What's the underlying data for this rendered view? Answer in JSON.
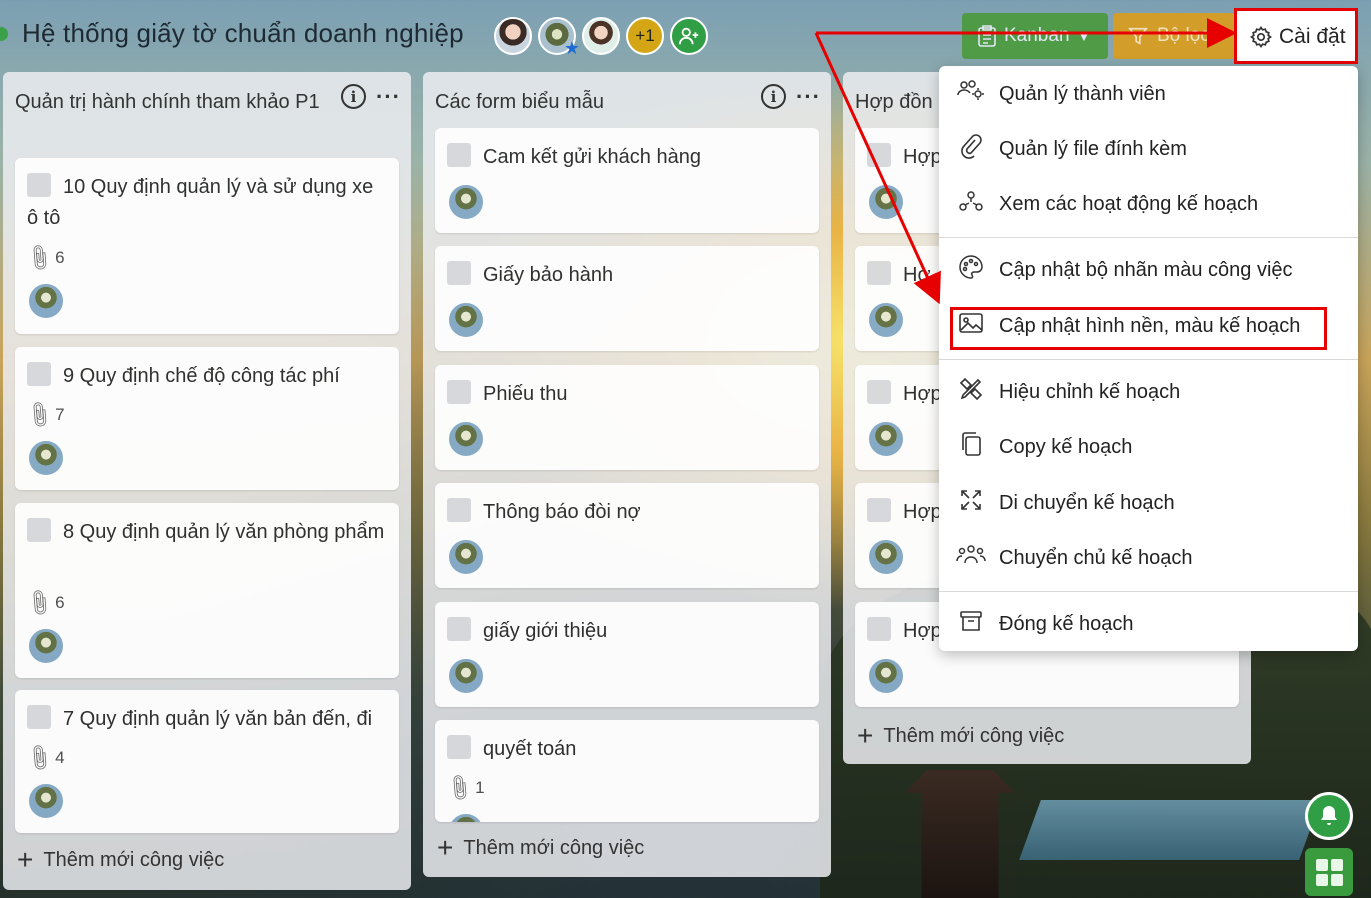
{
  "header": {
    "board_title": "Hệ thống giấy tờ chuẩn doanh nghiệp",
    "more_members": "+1",
    "view_label": "Kanban",
    "filter_label": "Bộ lọc",
    "settings_label": "Cài đặt"
  },
  "columns": [
    {
      "title": "Quản trị hành chính tham khảo P1",
      "cards": [
        {
          "title": "10 Quy định quản lý và sử dụng xe ô tô",
          "attachments": "6"
        },
        {
          "title": "9 Quy định chế độ công tác phí",
          "attachments": "7"
        },
        {
          "title": "8 Quy định quản lý văn phòng phẩm",
          "attachments": "6"
        },
        {
          "title": "7 Quy định quản lý văn bản đến, đi",
          "attachments": "4"
        }
      ],
      "add_task": "Thêm mới công việc"
    },
    {
      "title": "Các form biểu mẫu",
      "cards": [
        {
          "title": "Cam kết gửi khách hàng"
        },
        {
          "title": "Giấy bảo hành"
        },
        {
          "title": "Phiếu thu"
        },
        {
          "title": "Thông báo đòi nợ"
        },
        {
          "title": "giấy giới thiệu"
        },
        {
          "title": "quyết toán",
          "attachments": "1"
        }
      ],
      "add_task": "Thêm mới công việc"
    },
    {
      "title": "Hợp đồn",
      "cards": [
        {
          "title": "Hợp"
        },
        {
          "title": "Hợ"
        },
        {
          "title": "Hợp"
        },
        {
          "title": "Hợp"
        },
        {
          "title": "Hợp"
        }
      ],
      "add_task": "Thêm mới công việc"
    }
  ],
  "settings_menu": {
    "items": [
      {
        "label": "Quản lý thành viên",
        "icon": "members-gear-icon"
      },
      {
        "label": "Quản lý file đính kèm",
        "icon": "paperclip-icon"
      },
      {
        "label": "Xem các hoạt động kế hoạch",
        "icon": "activity-icon"
      },
      {
        "label": "Cập nhật bộ nhãn màu công việc",
        "icon": "palette-icon"
      },
      {
        "label": "Cập nhật hình nền, màu kế hoạch",
        "icon": "image-icon",
        "highlighted": true
      },
      {
        "label": "Hiệu chỉnh kế hoạch",
        "icon": "edit-tools-icon"
      },
      {
        "label": "Copy kế hoạch",
        "icon": "copy-icon"
      },
      {
        "label": "Di chuyển kế hoạch",
        "icon": "move-arrows-icon"
      },
      {
        "label": "Chuyển chủ kế hoạch",
        "icon": "transfer-owner-icon"
      },
      {
        "label": "Đóng kế hoạch",
        "icon": "archive-box-icon"
      }
    ]
  },
  "colors": {
    "annotation_red": "#e60000",
    "brand_green": "#2f9e44",
    "filter_orange": "#d79d22"
  }
}
